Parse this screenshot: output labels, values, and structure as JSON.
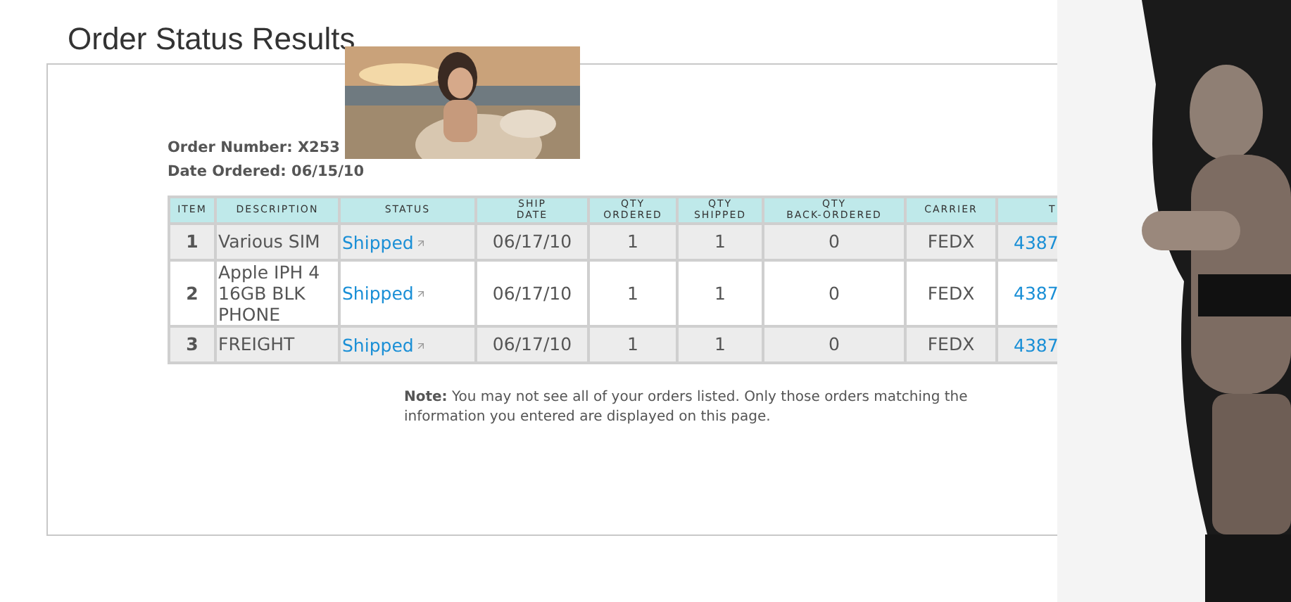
{
  "page": {
    "title": "Order Status Results"
  },
  "order": {
    "number_label": "Order Number:",
    "number": "X253",
    "date_label": "Date Ordered:",
    "date": "06/15/10"
  },
  "table": {
    "columns": [
      [
        "ITEM"
      ],
      [
        "DESCRIPTION"
      ],
      [
        "STATUS"
      ],
      [
        "SHIP",
        "DATE"
      ],
      [
        "QTY",
        "ORDERED"
      ],
      [
        "QTY",
        "SHIPPED"
      ],
      [
        "QTY",
        "BACK-ORDERED"
      ],
      [
        "CARRIER"
      ],
      [
        "T"
      ]
    ],
    "rows": [
      {
        "item": "1",
        "description": "Various SIM",
        "status": "Shipped",
        "ship_date": "06/17/10",
        "qty_ordered": "1",
        "qty_shipped": "1",
        "qty_back_ordered": "0",
        "carrier": "FEDX",
        "column_9": "4387"
      },
      {
        "item": "2",
        "description": "Apple IPH 4 16GB BLK PHONE",
        "status": "Shipped",
        "ship_date": "06/17/10",
        "qty_ordered": "1",
        "qty_shipped": "1",
        "qty_back_ordered": "0",
        "carrier": "FEDX",
        "column_9": "4387"
      },
      {
        "item": "3",
        "description": "FREIGHT",
        "status": "Shipped",
        "ship_date": "06/17/10",
        "qty_ordered": "1",
        "qty_shipped": "1",
        "qty_back_ordered": "0",
        "carrier": "FEDX",
        "column_9": "4387"
      }
    ]
  },
  "note": "**Note:** You may not see all of your orders listed. Only those orders matching the information you entered are displayed on this page."
}
